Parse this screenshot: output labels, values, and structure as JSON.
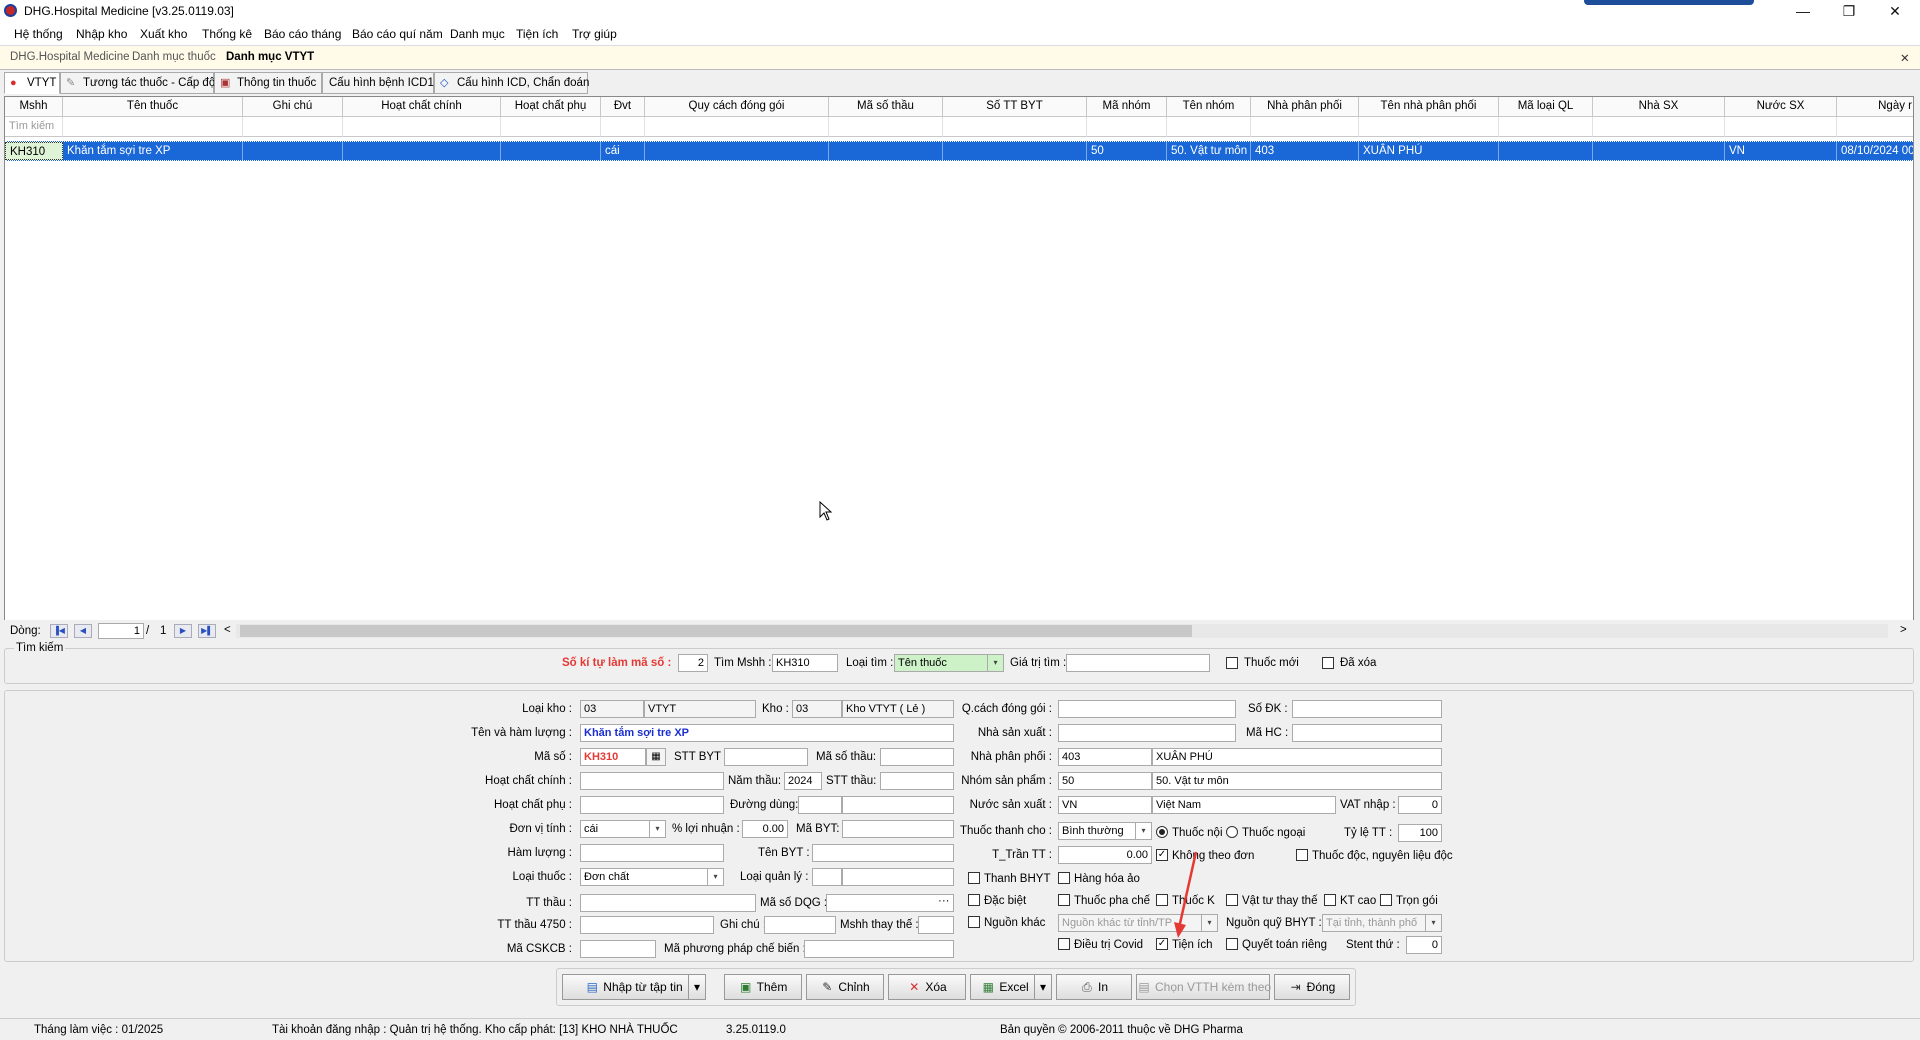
{
  "window": {
    "title": "DHG.Hospital Medicine [v3.25.0119.03]",
    "min": "—",
    "restore": "❐",
    "close": "✕"
  },
  "menu": [
    "Hệ thống",
    "Nhập kho",
    "Xuất kho",
    "Thống kê",
    "Báo cáo tháng",
    "Báo cáo quí năm",
    "Danh mục",
    "Tiện ích",
    "Trợ giúp"
  ],
  "doc_tabs": [
    "DHG.Hospital Medicine",
    "Danh mục thuốc",
    "Danh mục VTYT"
  ],
  "doc_close": "✕",
  "func_tabs": [
    "VTYT",
    "Tương tác thuốc - Cấp độ",
    "Thông tin thuốc",
    "Cấu hình bệnh ICD10",
    "Cấu hình ICD, Chẩn đoán"
  ],
  "grid": {
    "columns": [
      "Mshh",
      "Tên thuốc",
      "Ghi chú",
      "Hoạt chất chính",
      "Hoạt chất phụ",
      "Đvt",
      "Quy cách đóng gói",
      "Mã số thầu",
      "Số TT BYT",
      "Mã nhóm",
      "Tên nhóm",
      "Nhà phân phối",
      "Tên nhà phân phối",
      "Mã loại QL",
      "Nhà SX",
      "Nước SX",
      "Ngày r"
    ],
    "filter_placeholder": "Tìm kiếm",
    "rows": [
      [
        "KH310",
        "Khăn tắm sợi tre XP",
        "",
        "",
        "",
        "cái",
        "",
        "",
        "",
        "50",
        "50. Vật tư môn",
        "403",
        "XUÂN PHÚ",
        "",
        "",
        "VN",
        "08/10/2024 00"
      ]
    ]
  },
  "navigator": {
    "label": "Dòng:",
    "current": "1",
    "sep": "/",
    "total": "1",
    "first": "▐◀",
    "prev": "◀",
    "next": "▶",
    "last": "▶▌",
    "left": "<",
    "right": ">"
  },
  "search": {
    "group_label": "Tìm kiếm",
    "so_ki_tu_label": "Số kí tự làm mã số :",
    "so_ki_tu_value": "2",
    "tim_mshh_label": "Tìm Mshh :",
    "tim_mshh_value": "KH310",
    "loai_tim_label": "Loại tìm :",
    "loai_tim_value": "Tên thuốc",
    "gia_tri_tim_label": "Giá trị tìm :",
    "gia_tri_tim_value": "",
    "thuoc_moi_label": "Thuốc mới",
    "da_xoa_label": "Đã xóa"
  },
  "form": {
    "loai_kho_label": "Loại kho :",
    "loai_kho_code": "03",
    "loai_kho_name": "VTYT",
    "kho_label": "Kho :",
    "kho_code": "03",
    "kho_name": "Kho VTYT ( Lẻ )",
    "ten_label": "Tên và hàm lượng :",
    "ten_value": "Khăn tắm sợi tre XP",
    "ma_so_label": "Mã số :",
    "ma_so_value": "KH310",
    "stt_byt_label": "STT BYT :",
    "stt_byt_value": "",
    "ma_so_thau_label": "Mã số thầu:",
    "ma_so_thau_value": "",
    "hc_chinh_label": "Hoạt chất chính :",
    "hc_chinh_value": "",
    "nam_thau_label": "Năm thầu:",
    "nam_thau_value": "2024",
    "stt_thau_label": "STT thầu:",
    "stt_thau_value": "",
    "hc_phu_label": "Hoạt chất phụ :",
    "hc_phu_value": "",
    "duong_dung_label": "Đường dùng:",
    "duong_dung_value": "",
    "dvt_label": "Đơn vị tính :",
    "dvt_value": "cái",
    "loi_nhuan_label": "% lợi nhuận :",
    "loi_nhuan_value": "0.00",
    "ma_byt_label": "Mã BYT:",
    "ma_byt_value": "",
    "ham_luong_label": "Hàm lượng :",
    "ham_luong_value": "",
    "ten_byt_label": "Tên BYT :",
    "ten_byt_value": "",
    "loai_thuoc_label": "Loại thuốc :",
    "loai_thuoc_value": "Đơn chất",
    "loai_ql_label": "Loại quản lý :",
    "loai_ql_value": "",
    "tt_thau_label": "TT thầu :",
    "tt_thau_value": "",
    "ma_dqg_label": "Mã số DQG :",
    "ma_dqg_value": "",
    "ellipsis": "···",
    "tt4750_label": "TT thầu 4750 :",
    "tt4750_value": "",
    "ghi_chu_label": "Ghi chú :",
    "ghi_chu_value": "",
    "mshh_thay_label": "Mshh thay thế :",
    "mshh_thay_value": "",
    "ma_cskcb_label": "Mã CSKCB :",
    "ma_cskcb_value": "",
    "ma_ppcb_label": "Mã phương pháp chế biến :",
    "ma_ppcb_value": "",
    "qc_label": "Q.cách đóng gói :",
    "qc_value": "",
    "so_dk_label": "Số ĐK :",
    "so_dk_value": "",
    "nsx_label": "Nhà sản xuất :",
    "nsx_value": "",
    "ma_hc_label": "Mã HC :",
    "ma_hc_value": "",
    "npp_label": "Nhà phân phối :",
    "npp_code": "403",
    "npp_name": "XUÂN PHÚ",
    "nhom_label": "Nhóm sản phẩm :",
    "nhom_code": "50",
    "nhom_name": "50. Vật tư môn",
    "nuoc_label": "Nước sản xuất :",
    "nuoc_code": "VN",
    "nuoc_name": "Việt Nam",
    "vat_label": "VAT nhập :",
    "vat_value": "0",
    "thanh_cho_label": "Thuốc thanh cho :",
    "thanh_cho_value": "Bình thường",
    "thuoc_noi_label": "Thuốc nội",
    "thuoc_ngoai_label": "Thuốc ngoại",
    "ty_le_label": "Tỷ lệ TT :",
    "ty_le_value": "100",
    "tran_label": "T_Trần TT :",
    "tran_value": "0.00",
    "khong_theo_don_label": "Không theo đơn",
    "doc_label": "Thuốc độc, nguyên liệu độc",
    "thanh_bhyt_label": "Thanh BHYT",
    "hang_hoa_ao_label": "Hàng hóa ảo",
    "dac_biet_label": "Đặc biệt",
    "pha_che_label": "Thuốc pha chế",
    "thuoc_k_label": "Thuốc K",
    "vt_thay_the_label": "Vật tư thay thế",
    "kt_cao_label": "KT cao",
    "tron_goi_label": "Trọn gói",
    "nguon_khac_label": "Nguồn khác",
    "nguon_khac_value": "Nguồn khác từ tỉnh/TP",
    "nguon_quy_label": "Nguồn quỹ BHYT :",
    "nguon_quy_value": "Tại tỉnh, thành phố",
    "covid_label": "Điều trị Covid",
    "tien_ich_label": "Tiện ích",
    "qt_rieng_label": "Quyết toán riêng",
    "stent_label": "Stent thứ :",
    "stent_value": "0",
    "check": "✓"
  },
  "buttons": {
    "import": "Nhập từ tập tin",
    "add": "Thêm",
    "edit": "Chỉnh",
    "delete": "Xóa",
    "excel": "Excel",
    "print": "In",
    "choose": "Chọn VTTH kèm theo",
    "close": "Đóng",
    "arrow": "▾"
  },
  "status": {
    "month": "Tháng làm việc : 01/2025",
    "account": "Tài khoản đăng nhập : Quản trị hệ thống. Kho cấp phát: [13] KHO NHÀ THUỐC",
    "version": "3.25.0119.0",
    "copyright": "Bản quyền © 2006-2011 thuộc về DHG Pharma"
  },
  "colors": {
    "selection": "#1a67d8",
    "required_label": "#e53935",
    "name_value": "#1a2fd0"
  }
}
